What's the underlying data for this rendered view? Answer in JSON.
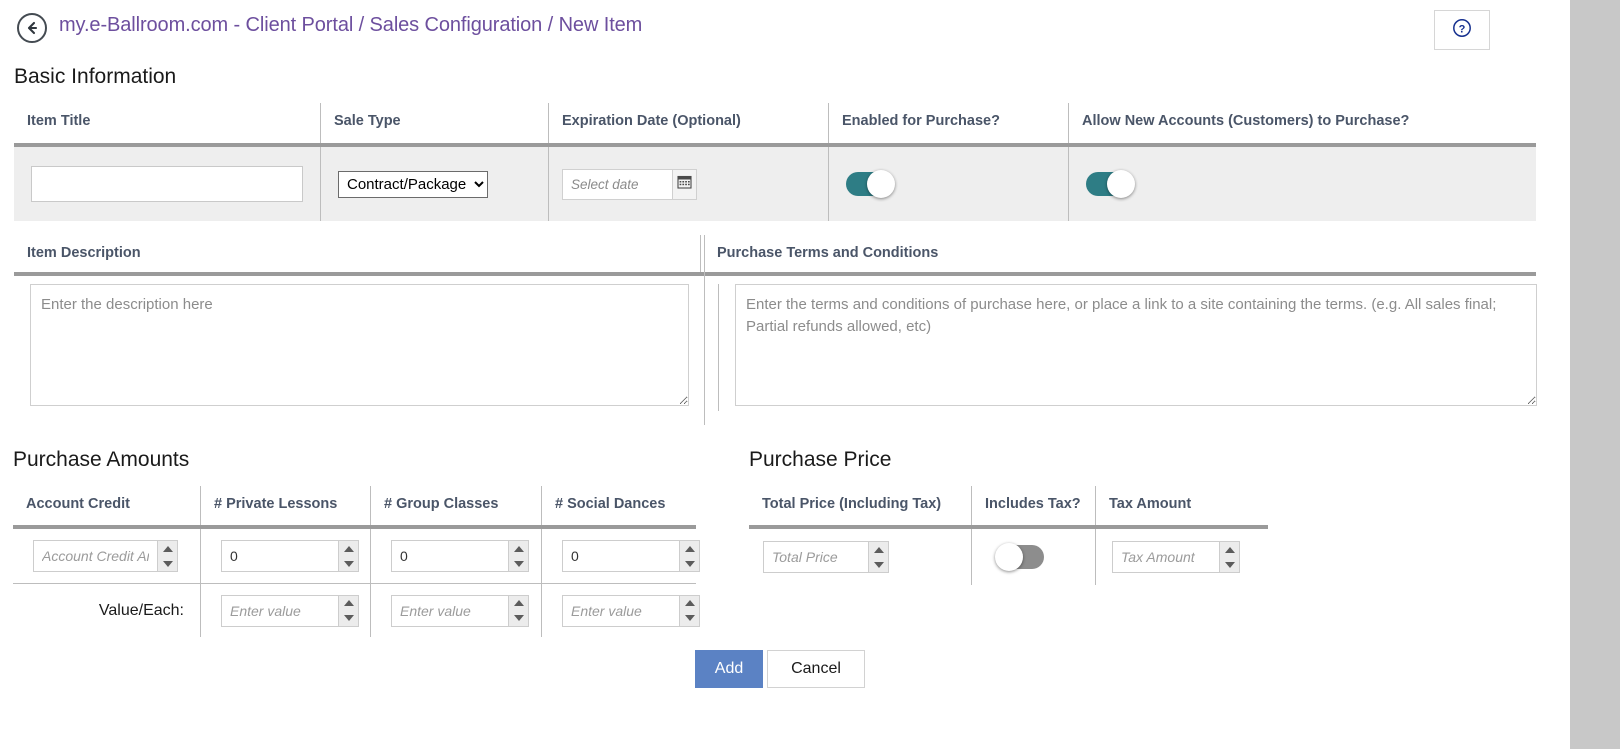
{
  "header": {
    "back_icon": "back-arrow-icon",
    "breadcrumb": "my.e-Ballroom.com - Client Portal / Sales Configuration / New Item",
    "help_icon": "question-mark-circle-icon"
  },
  "basic_information": {
    "title": "Basic Information",
    "columns": [
      "Item Title",
      "Sale Type",
      "Expiration Date (Optional)",
      "Enabled for Purchase?",
      "Allow New Accounts (Customers) to Purchase?"
    ],
    "item_title": {
      "value": "",
      "placeholder": ""
    },
    "sale_type": {
      "selected": "Contract/Package",
      "options": [
        "Contract/Package"
      ]
    },
    "expiration_date": {
      "value": "",
      "placeholder": "Select date",
      "calendar_icon": "calendar-icon"
    },
    "enabled_for_purchase": {
      "state": "on",
      "color": "#2e7d85"
    },
    "allow_new_accounts": {
      "state": "on",
      "color": "#2e7d85"
    }
  },
  "descriptions": {
    "item_description_label": "Item Description",
    "item_description": {
      "value": "",
      "placeholder": "Enter the description here"
    },
    "terms_label": "Purchase Terms and Conditions",
    "terms": {
      "value": "",
      "placeholder": "Enter the terms and conditions of purchase here, or place a link to a site containing the terms. (e.g. All sales final; Partial refunds allowed, etc)"
    }
  },
  "purchase_amounts": {
    "title": "Purchase Amounts",
    "columns": [
      "Account Credit",
      "# Private Lessons",
      "# Group Classes",
      "# Social Dances"
    ],
    "row1": [
      {
        "value": "",
        "placeholder": "Account Credit Amount"
      },
      {
        "value": "0",
        "placeholder": ""
      },
      {
        "value": "0",
        "placeholder": ""
      },
      {
        "value": "0",
        "placeholder": ""
      }
    ],
    "value_each_label": "Value/Each:",
    "row2": [
      {
        "value": "",
        "placeholder": "Enter value"
      },
      {
        "value": "",
        "placeholder": "Enter value"
      },
      {
        "value": "",
        "placeholder": "Enter value"
      }
    ]
  },
  "purchase_price": {
    "title": "Purchase Price",
    "columns": [
      "Total Price (Including Tax)",
      "Includes Tax?",
      "Tax Amount"
    ],
    "total_price": {
      "value": "",
      "placeholder": "Total Price"
    },
    "includes_tax": {
      "state": "off",
      "color": "#8d8d8d"
    },
    "tax_amount": {
      "value": "",
      "placeholder": "Tax Amount"
    }
  },
  "actions": {
    "add_label": "Add",
    "cancel_label": "Cancel",
    "add_color": "#5b82c4"
  }
}
